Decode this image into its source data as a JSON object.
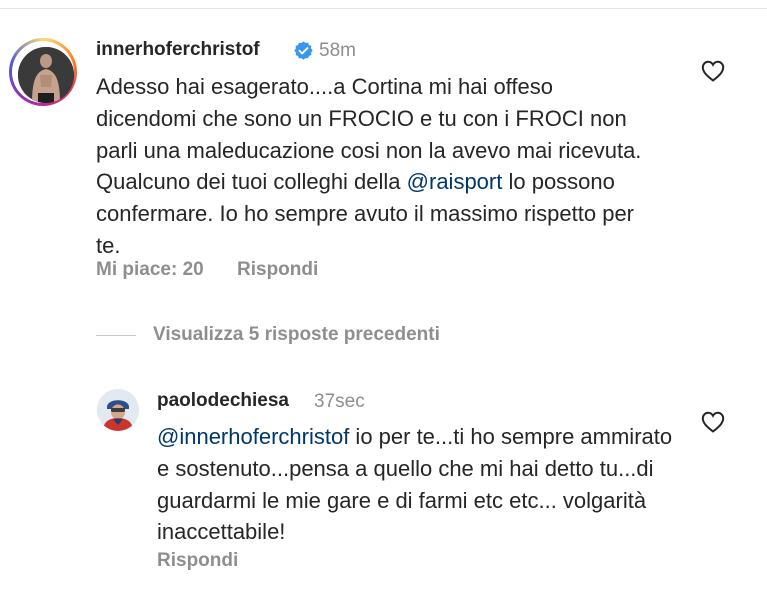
{
  "main_comment": {
    "username": "innerhoferchristof",
    "verified": true,
    "time": "58m",
    "text_before": "Adesso hai esagerato....a Cortina mi hai offeso dicendomi che sono un FROCIO e tu con i FROCI non parli una maleducazione cosi non la avevo mai ricevuta. Qualcuno dei tuoi colleghi della ",
    "mention": "@raisport",
    "text_after": " lo possono confermare. Io ho sempre avuto il massimo rispetto per te.",
    "likes_label": "Mi piace: 20",
    "reply_label": "Rispondi"
  },
  "view_replies": {
    "label": "Visualizza 5 risposte precedenti"
  },
  "reply_comment": {
    "username": "paolodechiesa",
    "time": "37sec",
    "mention": "@innerhoferchristof",
    "text_after": " io per te...ti ho sempre ammirato e sostenuto...pensa a quello che mi hai detto tu...di guardarmi le mie gare e di farmi etc etc... volgarità inaccettabile!",
    "reply_label": "Rispondi"
  },
  "colors": {
    "text": "#262626",
    "secondary": "#8e8e8e",
    "mention": "#00376b",
    "verified": "#3897f0"
  }
}
